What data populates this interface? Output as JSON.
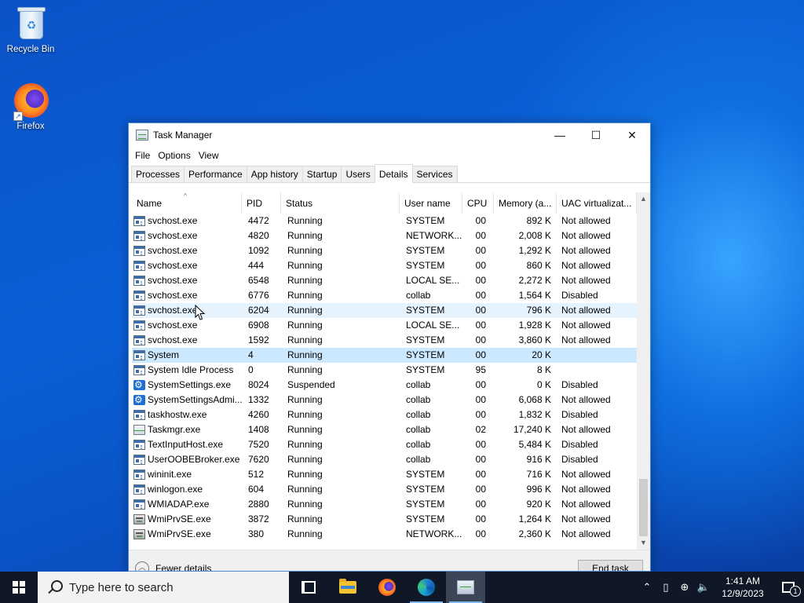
{
  "desktop": {
    "icons": [
      {
        "label": "Recycle Bin"
      },
      {
        "label": "Firefox"
      }
    ]
  },
  "window": {
    "title": "Task Manager",
    "controls": {
      "minimize": "—",
      "maximize": "☐",
      "close": "✕"
    },
    "menu": [
      "File",
      "Options",
      "View"
    ],
    "tabs": [
      "Processes",
      "Performance",
      "App history",
      "Startup",
      "Users",
      "Details",
      "Services"
    ],
    "active_tab": "Details",
    "columns": [
      "Name",
      "PID",
      "Status",
      "User name",
      "CPU",
      "Memory (a...",
      "UAC virtualizat..."
    ],
    "sort_indicator": "^",
    "rows": [
      {
        "name": "svchost.exe",
        "pid": "4472",
        "status": "Running",
        "user": "SYSTEM",
        "cpu": "00",
        "mem": "892 K",
        "uac": "Not allowed",
        "icon": "process-icon"
      },
      {
        "name": "svchost.exe",
        "pid": "4820",
        "status": "Running",
        "user": "NETWORK...",
        "cpu": "00",
        "mem": "2,008 K",
        "uac": "Not allowed",
        "icon": "process-icon"
      },
      {
        "name": "svchost.exe",
        "pid": "1092",
        "status": "Running",
        "user": "SYSTEM",
        "cpu": "00",
        "mem": "1,292 K",
        "uac": "Not allowed",
        "icon": "process-icon"
      },
      {
        "name": "svchost.exe",
        "pid": "444",
        "status": "Running",
        "user": "SYSTEM",
        "cpu": "00",
        "mem": "860 K",
        "uac": "Not allowed",
        "icon": "process-icon"
      },
      {
        "name": "svchost.exe",
        "pid": "6548",
        "status": "Running",
        "user": "LOCAL SE...",
        "cpu": "00",
        "mem": "2,272 K",
        "uac": "Not allowed",
        "icon": "process-icon"
      },
      {
        "name": "svchost.exe",
        "pid": "6776",
        "status": "Running",
        "user": "collab",
        "cpu": "00",
        "mem": "1,564 K",
        "uac": "Disabled",
        "icon": "process-icon"
      },
      {
        "name": "svchost.exe",
        "pid": "6204",
        "status": "Running",
        "user": "SYSTEM",
        "cpu": "00",
        "mem": "796 K",
        "uac": "Not allowed",
        "icon": "process-icon",
        "state": "hover"
      },
      {
        "name": "svchost.exe",
        "pid": "6908",
        "status": "Running",
        "user": "LOCAL SE...",
        "cpu": "00",
        "mem": "1,928 K",
        "uac": "Not allowed",
        "icon": "process-icon"
      },
      {
        "name": "svchost.exe",
        "pid": "1592",
        "status": "Running",
        "user": "SYSTEM",
        "cpu": "00",
        "mem": "3,860 K",
        "uac": "Not allowed",
        "icon": "process-icon"
      },
      {
        "name": "System",
        "pid": "4",
        "status": "Running",
        "user": "SYSTEM",
        "cpu": "00",
        "mem": "20 K",
        "uac": "",
        "icon": "process-icon",
        "state": "selected"
      },
      {
        "name": "System Idle Process",
        "pid": "0",
        "status": "Running",
        "user": "SYSTEM",
        "cpu": "95",
        "mem": "8 K",
        "uac": "",
        "icon": "process-icon"
      },
      {
        "name": "SystemSettings.exe",
        "pid": "8024",
        "status": "Suspended",
        "user": "collab",
        "cpu": "00",
        "mem": "0 K",
        "uac": "Disabled",
        "icon": "gear-icon"
      },
      {
        "name": "SystemSettingsAdmi...",
        "pid": "1332",
        "status": "Running",
        "user": "collab",
        "cpu": "00",
        "mem": "6,068 K",
        "uac": "Not allowed",
        "icon": "gear-icon"
      },
      {
        "name": "taskhostw.exe",
        "pid": "4260",
        "status": "Running",
        "user": "collab",
        "cpu": "00",
        "mem": "1,832 K",
        "uac": "Disabled",
        "icon": "process-icon"
      },
      {
        "name": "Taskmgr.exe",
        "pid": "1408",
        "status": "Running",
        "user": "collab",
        "cpu": "02",
        "mem": "17,240 K",
        "uac": "Not allowed",
        "icon": "task-manager-icon"
      },
      {
        "name": "TextInputHost.exe",
        "pid": "7520",
        "status": "Running",
        "user": "collab",
        "cpu": "00",
        "mem": "5,484 K",
        "uac": "Disabled",
        "icon": "process-icon"
      },
      {
        "name": "UserOOBEBroker.exe",
        "pid": "7620",
        "status": "Running",
        "user": "collab",
        "cpu": "00",
        "mem": "916 K",
        "uac": "Disabled",
        "icon": "process-icon"
      },
      {
        "name": "wininit.exe",
        "pid": "512",
        "status": "Running",
        "user": "SYSTEM",
        "cpu": "00",
        "mem": "716 K",
        "uac": "Not allowed",
        "icon": "process-icon"
      },
      {
        "name": "winlogon.exe",
        "pid": "604",
        "status": "Running",
        "user": "SYSTEM",
        "cpu": "00",
        "mem": "996 K",
        "uac": "Not allowed",
        "icon": "process-icon"
      },
      {
        "name": "WMIADAP.exe",
        "pid": "2880",
        "status": "Running",
        "user": "SYSTEM",
        "cpu": "00",
        "mem": "920 K",
        "uac": "Not allowed",
        "icon": "process-icon"
      },
      {
        "name": "WmiPrvSE.exe",
        "pid": "3872",
        "status": "Running",
        "user": "SYSTEM",
        "cpu": "00",
        "mem": "1,264 K",
        "uac": "Not allowed",
        "icon": "wmi-icon"
      },
      {
        "name": "WmiPrvSE.exe",
        "pid": "380",
        "status": "Running",
        "user": "NETWORK...",
        "cpu": "00",
        "mem": "2,360 K",
        "uac": "Not allowed",
        "icon": "wmi-icon"
      }
    ],
    "footer": {
      "fewer_details": "Fewer details",
      "end_task": "End task"
    }
  },
  "taskbar": {
    "search_placeholder": "Type here to search",
    "apps": [
      {
        "name": "task-view-icon",
        "state": "idle"
      },
      {
        "name": "file-explorer-icon",
        "state": "idle"
      },
      {
        "name": "firefox-icon",
        "state": "idle"
      },
      {
        "name": "edge-icon",
        "state": "running"
      },
      {
        "name": "task-manager-icon",
        "state": "active"
      }
    ],
    "tray": {
      "time": "1:41 AM",
      "date": "12/9/2023",
      "notifications": "1"
    }
  },
  "colors": {
    "selection": "#cce8ff",
    "hover": "#e5f3ff",
    "taskbar": "#101828",
    "window_border": "#4a8bd6"
  }
}
